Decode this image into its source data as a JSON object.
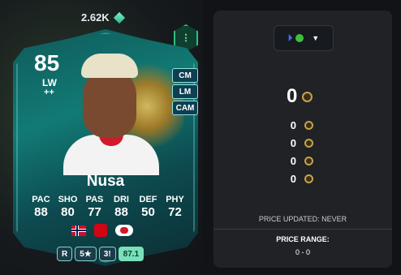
{
  "card_header": {
    "price": "2.62K"
  },
  "card": {
    "rating": "85",
    "position": "LW",
    "playstyle_plus": "++",
    "alt_positions": [
      "CM",
      "LM",
      "CAM"
    ],
    "name": "Nusa",
    "stats": [
      {
        "label": "PAC",
        "value": "88"
      },
      {
        "label": "SHO",
        "value": "80"
      },
      {
        "label": "PAS",
        "value": "77"
      },
      {
        "label": "DRI",
        "value": "88"
      },
      {
        "label": "DEF",
        "value": "50"
      },
      {
        "label": "PHY",
        "value": "72"
      }
    ],
    "bottom": {
      "foot": "R",
      "skill": "5★",
      "weak_foot": "3!",
      "overall": "87.1"
    }
  },
  "panel": {
    "main_price": "0",
    "prices": [
      "0",
      "0",
      "0",
      "0"
    ],
    "updated": "PRICE UPDATED: NEVER",
    "range_label": "PRICE RANGE:",
    "range_value": "0 - 0"
  },
  "colors": {
    "accent": "#79e0b9",
    "panel": "#202226",
    "coin": "#c9a24a"
  },
  "icons": [
    "gem-icon",
    "evolution-icon",
    "playstation-icon",
    "xbox-icon",
    "chevron-down-icon",
    "coin-icon",
    "norway-flag-icon",
    "bundesliga-icon",
    "leipzig-icon"
  ]
}
